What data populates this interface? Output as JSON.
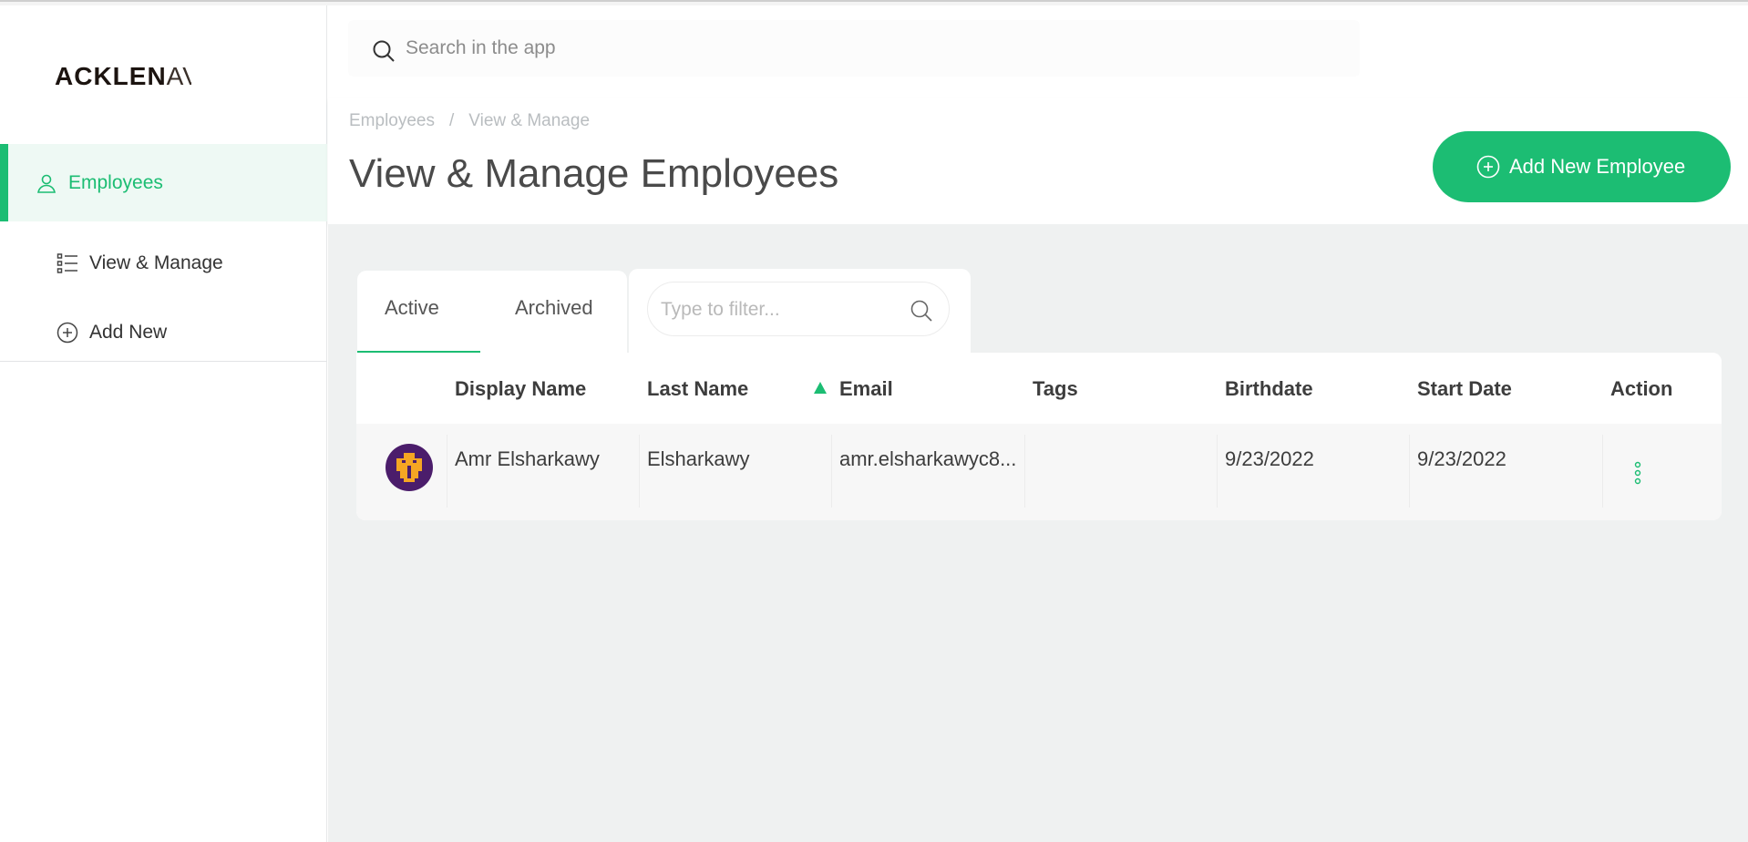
{
  "app": {
    "logo_bold": "ACKLEN",
    "logo_rest": "AV"
  },
  "sidebar": {
    "active_section": {
      "label": "Employees",
      "icon": "user-icon"
    },
    "items": [
      {
        "label": "View & Manage",
        "icon": "list-icon"
      },
      {
        "label": "Add New",
        "icon": "plus-circle-icon"
      }
    ]
  },
  "search": {
    "placeholder": "Search in the app",
    "value": ""
  },
  "header": {
    "breadcrumb": [
      "Employees",
      "View & Manage"
    ],
    "breadcrumb_separator": "/",
    "title": "View & Manage Employees",
    "add_button_label": "Add New Employee"
  },
  "tabs": [
    {
      "label": "Active",
      "selected": true
    },
    {
      "label": "Archived",
      "selected": false
    }
  ],
  "filter": {
    "placeholder": "Type to filter...",
    "value": ""
  },
  "table": {
    "columns": [
      "Display Name",
      "Last Name",
      "Email",
      "Tags",
      "Birthdate",
      "Start Date",
      "Action"
    ],
    "sorted_column": "Email",
    "sort_direction": "ascending",
    "rows": [
      {
        "display_name": "Amr Elsharkawy",
        "last_name": "Elsharkawy",
        "email": "amr.elsharkawyc8...",
        "tags": "",
        "birthdate": "9/23/2022",
        "start_date": "9/23/2022"
      }
    ]
  },
  "colors": {
    "accent": "#1cbd73",
    "sidebar_active_bg": "#eef9f4",
    "content_bg": "#eff1f1",
    "avatar_bg": "#4b1d6b",
    "avatar_fg": "#f5a623"
  }
}
